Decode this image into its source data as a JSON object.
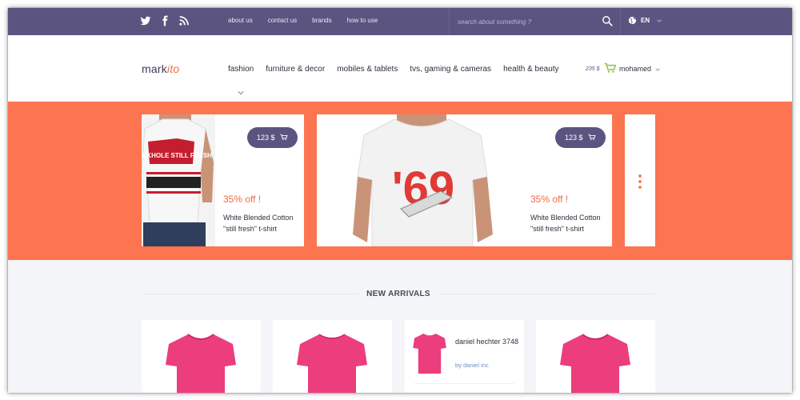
{
  "colors": {
    "topbar": "#5c5480",
    "accent": "#f26b45",
    "hero_bg": "#fd7450",
    "pill": "#5c5480",
    "product_pink": "#ec3d7c"
  },
  "topbar": {
    "social_icons": [
      "twitter-icon",
      "facebook-icon",
      "rss-icon"
    ],
    "links": [
      "about us",
      "contact us",
      "brands",
      "how to use"
    ],
    "search_placeholder": "search about something ?",
    "language": "EN"
  },
  "header": {
    "logo_main": "mark",
    "logo_accent": "ito",
    "nav": [
      "fashion",
      "furniture & decor",
      "mobiles & tablets",
      "tvs, gaming & cameras",
      "health & beauty"
    ],
    "cart_total": "235 $",
    "user_name": "mohamed"
  },
  "hero": {
    "cards": [
      {
        "price": "123 $",
        "discount": "35% off !",
        "title": "White Blended Cotton \"still fresh\" t-shirt",
        "print_text": "BLACKHOLE STILL FRESH"
      },
      {
        "price": "123 $",
        "discount": "35% off !",
        "title": "White Blended Cotton \"still fresh\" t-shirt",
        "print_text": "'69"
      }
    ]
  },
  "arrivals": {
    "title": "NEW ARRIVALS",
    "featured": {
      "name": "daniel hechter 3748",
      "brand": "by daniel inc"
    }
  }
}
